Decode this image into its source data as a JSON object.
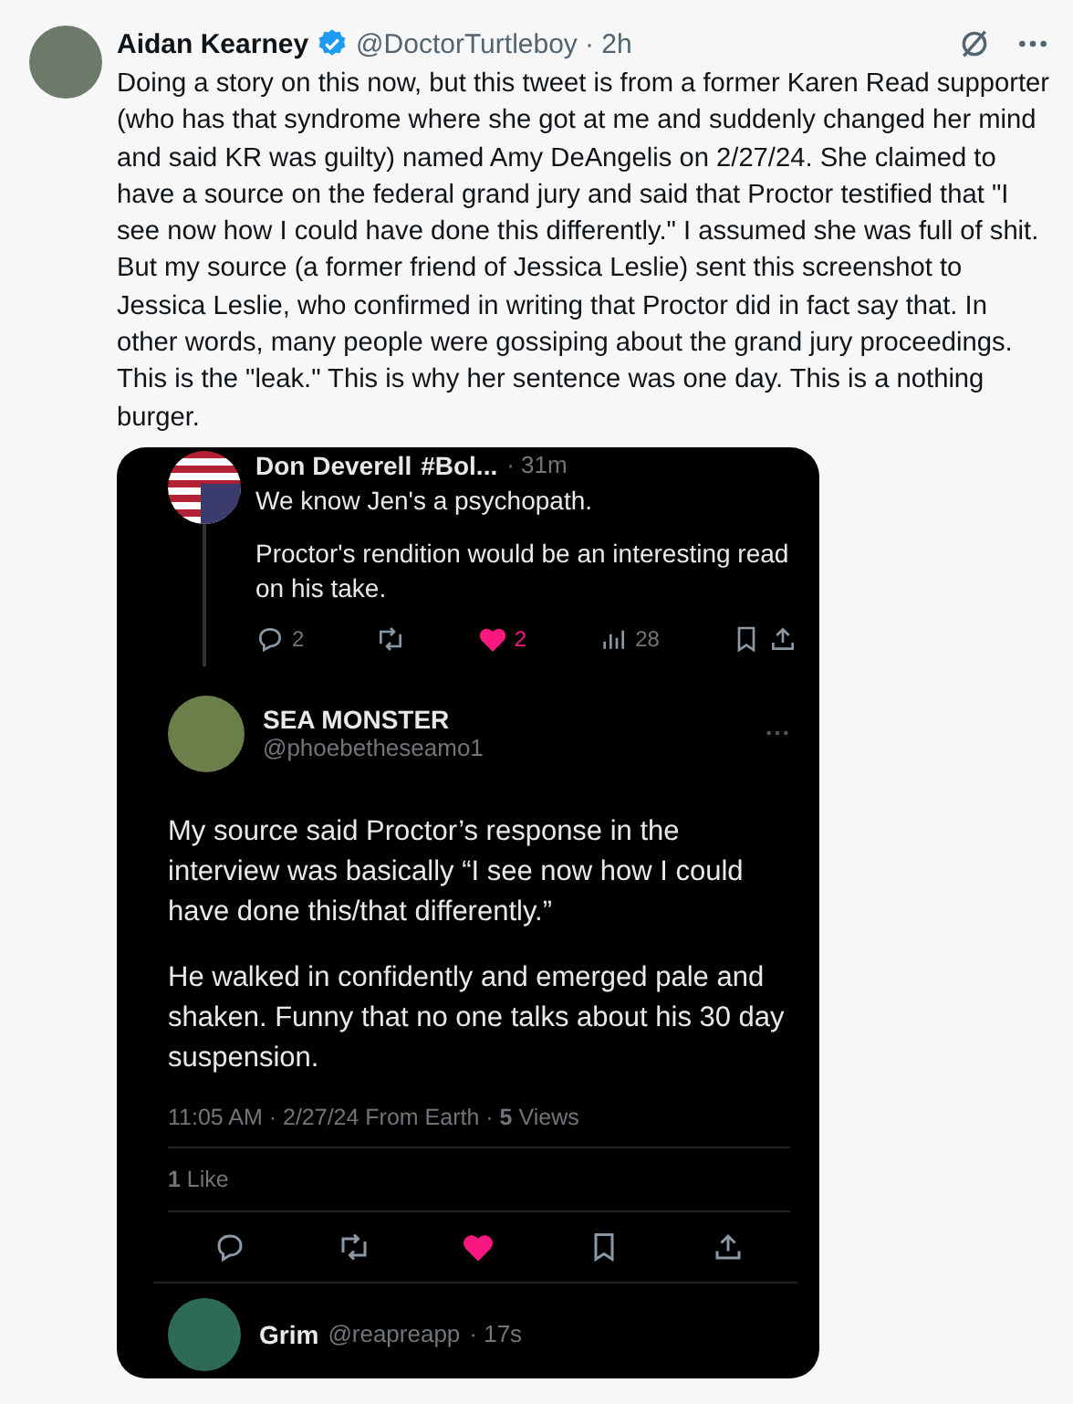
{
  "post": {
    "author": {
      "name": "Aidan Kearney",
      "verified": true,
      "handle": "@DoctorTurtleboy",
      "time": "· 2h"
    },
    "text": "Doing a story on this now, but this tweet is from a former Karen Read supporter (who has that syndrome where she got at me and suddenly changed her mind and said KR was guilty) named Amy DeAngelis on 2/27/24. She claimed to have a source on the federal grand jury and said that Proctor testified that \"I see now how I could have done this differently.\" I assumed she was full of shit. But my source (a former friend of Jessica Leslie) sent this screenshot to Jessica Leslie, who confirmed in writing that Proctor did in fact say that. In other words, many people were gossiping about the grand jury proceedings. This is the \"leak.\" This is why her sentence was one day. This is a nothing burger."
  },
  "screenshot": {
    "parent_reply": {
      "name": "Don Deverell",
      "tag": "#Bol...",
      "time": "· 31m",
      "paragraphs": [
        "We know Jen's a psychopath.",
        "Proctor's rendition would be an interesting read on his take."
      ],
      "replies": "2",
      "likes": "2",
      "liked": true,
      "views": "28"
    },
    "main_post": {
      "name": "SEA MONSTER",
      "handle": "@phoebetheseamo1",
      "paragraphs": [
        "My source said Proctor’s response in the interview was basically “I see now how I could have done this/that differently.”",
        "He walked in confidently and emerged pale and shaken. Funny that no one talks about his 30 day suspension."
      ],
      "meta": "11:05 AM · 2/27/24 From Earth · **5** Views",
      "like_count": "**1** Like",
      "liked": true
    },
    "next_reply": {
      "name": "Grim",
      "handle": "@reapreapp",
      "time": "· 17s"
    }
  }
}
